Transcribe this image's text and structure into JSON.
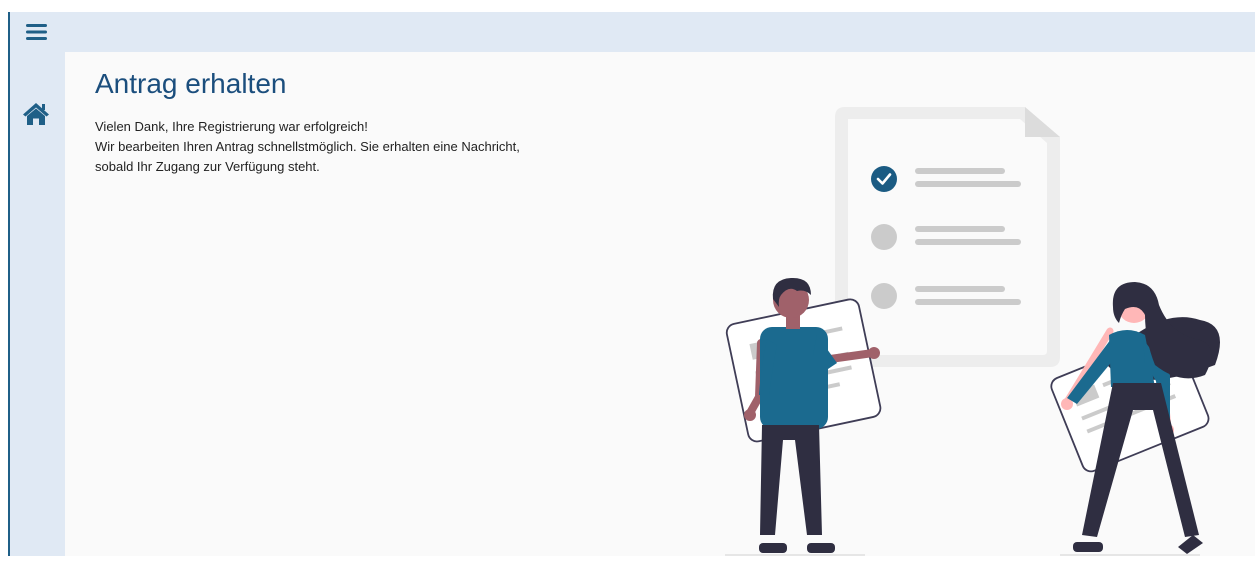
{
  "sidebar": {
    "menu_icon": "hamburger-menu-icon",
    "home_icon": "home-icon"
  },
  "main": {
    "title": "Antrag erhalten",
    "message_lines": [
      "Vielen Dank, Ihre Registrierung war erfolgreich!",
      "Wir bearbeiten Ihren Antrag schnellstmöglich. Sie erhalten eine Nachricht,",
      "sobald Ihr Zugang zur Verfügung steht."
    ]
  },
  "colors": {
    "accent": "#1f5f87",
    "sidebar_bg": "#e0e9f4",
    "title": "#1b4e7d",
    "checked": "#1b5b83",
    "figure_shirt": "#1b6a8f",
    "figure_pants": "#2f2e41"
  },
  "illustration": {
    "checklist_items": [
      {
        "state": "checked"
      },
      {
        "state": "unchecked"
      },
      {
        "state": "unchecked"
      }
    ]
  }
}
